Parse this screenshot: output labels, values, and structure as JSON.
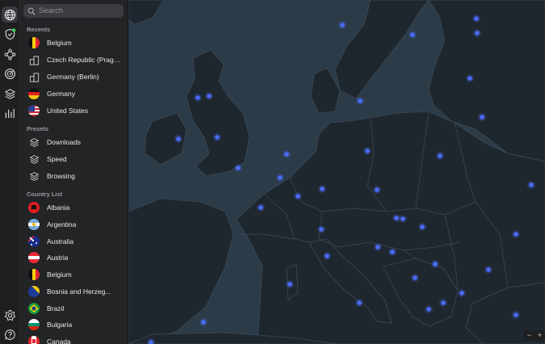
{
  "search": {
    "placeholder": "Search"
  },
  "rail": {
    "items": [
      {
        "icon": "globe-icon",
        "active": true
      },
      {
        "icon": "shield-icon"
      },
      {
        "icon": "meshnet-icon"
      },
      {
        "icon": "target-icon"
      },
      {
        "icon": "layers-icon"
      },
      {
        "icon": "stats-icon"
      },
      {
        "icon": "settings-icon"
      },
      {
        "icon": "help-icon"
      }
    ]
  },
  "recents": {
    "title": "Recents",
    "items": [
      {
        "label": "Belgium",
        "icon": "flag-belgium"
      },
      {
        "label": "Czech Republic (Prague)",
        "icon": "city-icon"
      },
      {
        "label": "Germany (Berlin)",
        "icon": "city-icon"
      },
      {
        "label": "Germany",
        "icon": "flag-germany"
      },
      {
        "label": "United States",
        "icon": "flag-united-states"
      }
    ]
  },
  "presets": {
    "title": "Presets",
    "items": [
      {
        "label": "Downloads",
        "icon": "layers-icon"
      },
      {
        "label": "Speed",
        "icon": "layers-icon"
      },
      {
        "label": "Browsing",
        "icon": "layers-icon"
      }
    ]
  },
  "country_list": {
    "title": "Country List",
    "items": [
      {
        "label": "Albania",
        "icon": "flag-albania"
      },
      {
        "label": "Argentina",
        "icon": "flag-argentina"
      },
      {
        "label": "Australia",
        "icon": "flag-australia"
      },
      {
        "label": "Austria",
        "icon": "flag-austria"
      },
      {
        "label": "Belgium",
        "icon": "flag-belgium"
      },
      {
        "label": "Bosnia and Herzeg...",
        "icon": "flag-bosnia"
      },
      {
        "label": "Brazil",
        "icon": "flag-brazil"
      },
      {
        "label": "Bulgaria",
        "icon": "flag-bulgaria"
      },
      {
        "label": "Canada",
        "icon": "flag-canada"
      }
    ]
  },
  "map": {
    "zoom_out": "−",
    "zoom_in": "+",
    "colors": {
      "sea": "#2b3b48",
      "land": "#1f272e",
      "border": "#3c4a56",
      "server": "#4a6cf7"
    }
  }
}
